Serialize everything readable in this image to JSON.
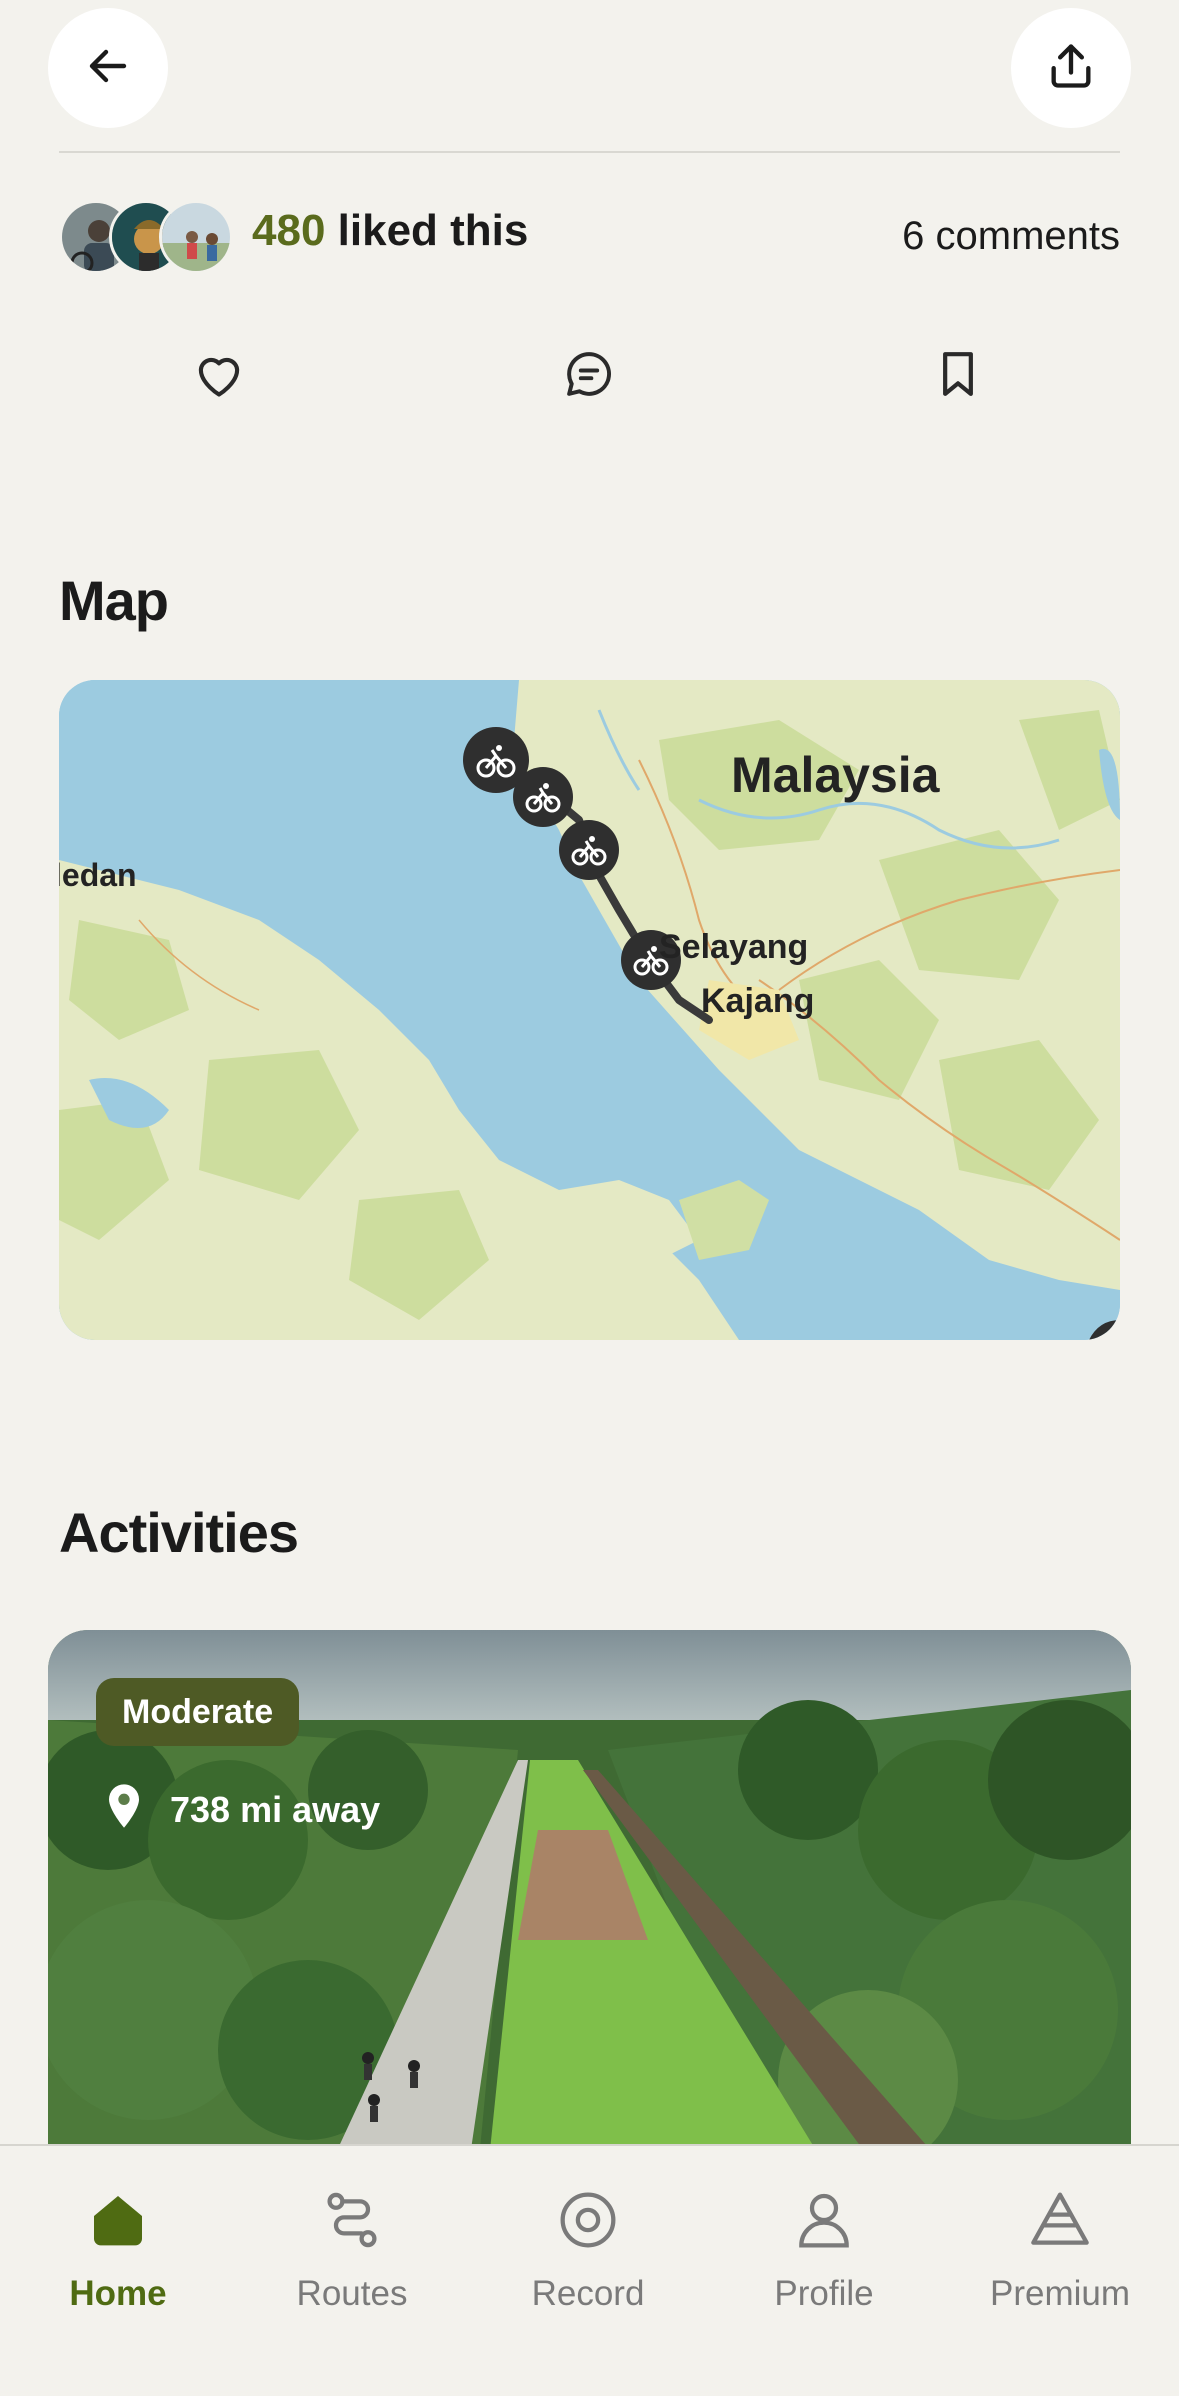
{
  "likes": {
    "count": "480",
    "suffix": " liked this",
    "comments": "6 comments"
  },
  "sections": {
    "map_title": "Map",
    "activities_title": "Activities"
  },
  "map": {
    "labels": {
      "country": "Malaysia",
      "city_left": "ledan",
      "city_1": "Selayang",
      "city_2": "Kajang"
    }
  },
  "activity": {
    "difficulty": "Moderate",
    "distance": "738 mi away"
  },
  "nav": {
    "items": [
      {
        "label": "Home",
        "icon": "home-icon",
        "active": true
      },
      {
        "label": "Routes",
        "icon": "routes-icon",
        "active": false
      },
      {
        "label": "Record",
        "icon": "record-icon",
        "active": false
      },
      {
        "label": "Profile",
        "icon": "profile-icon",
        "active": false
      },
      {
        "label": "Premium",
        "icon": "premium-icon",
        "active": false
      }
    ]
  },
  "colors": {
    "accent": "#4f6b12",
    "like_count": "#5a6b1d",
    "background": "#f3f2ed",
    "badge": "#4e5a25",
    "water": "#9ccbe0",
    "land": "#e4e9c4"
  }
}
